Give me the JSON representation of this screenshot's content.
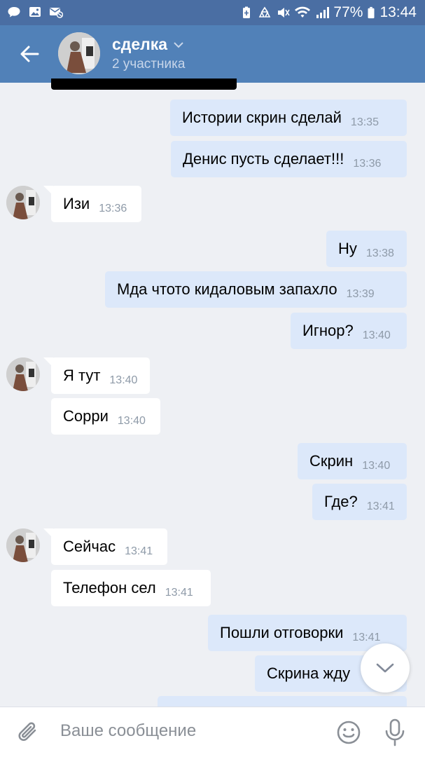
{
  "status_bar": {
    "battery": "77%",
    "time": "13:44"
  },
  "header": {
    "title": "сделка",
    "subtitle": "2 участника"
  },
  "composer": {
    "placeholder": "Ваше сообщение"
  },
  "messages": [
    {
      "text": "Истории скрин сделай",
      "time": "13:35",
      "direction": "out"
    },
    {
      "text": "Денис пусть сделает!!!",
      "time": "13:36",
      "direction": "out"
    },
    {
      "text": "Изи",
      "time": "13:36",
      "direction": "in"
    },
    {
      "text": "Ну",
      "time": "13:38",
      "direction": "out"
    },
    {
      "text": "Мда чтото кидаловым запахло",
      "time": "13:39",
      "direction": "out"
    },
    {
      "text": "Игнор?",
      "time": "13:40",
      "direction": "out"
    },
    {
      "text": "Я тут",
      "time": "13:40",
      "direction": "in"
    },
    {
      "text": "Сорри",
      "time": "13:40",
      "direction": "in"
    },
    {
      "text": "Скрин",
      "time": "13:40",
      "direction": "out"
    },
    {
      "text": "Где?",
      "time": "13:41",
      "direction": "out"
    },
    {
      "text": "Сейчас",
      "time": "13:41",
      "direction": "in"
    },
    {
      "text": "Телефон сел",
      "time": "13:41",
      "direction": "in"
    },
    {
      "text": "Пошли отговорки",
      "time": "13:41",
      "direction": "out"
    },
    {
      "text": "Скрина жду",
      "time": "",
      "direction": "out"
    }
  ]
}
